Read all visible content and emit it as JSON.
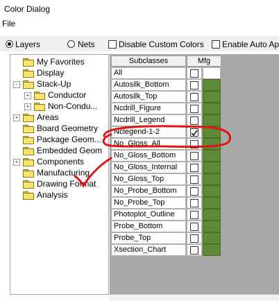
{
  "window": {
    "title": "Color Dialog"
  },
  "menubar": {
    "file": "File"
  },
  "toolbar": {
    "layers_label": "Layers",
    "nets_label": "Nets",
    "disable_custom_colors_label": "Disable Custom Colors",
    "enable_auto_apply_label": "Enable Auto Appl"
  },
  "tree": {
    "items": [
      {
        "label": "My Favorites"
      },
      {
        "label": "Display"
      },
      {
        "label": "Stack-Up",
        "expanded": true
      },
      {
        "label": "Conductor"
      },
      {
        "label": "Non-Condu..."
      },
      {
        "label": "Areas"
      },
      {
        "label": "Board Geometry"
      },
      {
        "label": "Package Geom..."
      },
      {
        "label": "Embedded Geom"
      },
      {
        "label": "Components"
      },
      {
        "label": "Manufacturing"
      },
      {
        "label": "Drawing Format"
      },
      {
        "label": "Analysis"
      }
    ]
  },
  "grid": {
    "header_subclasses": "Subclasses",
    "header_mfg": "Mfg",
    "mfg_color": "#5f8a35",
    "rows": [
      {
        "name": "All",
        "checked": false
      },
      {
        "name": "Autosilk_Bottom",
        "checked": false
      },
      {
        "name": "Autosilk_Top",
        "checked": false
      },
      {
        "name": "Ncdrill_Figure",
        "checked": false
      },
      {
        "name": "Ncdrill_Legend",
        "checked": false
      },
      {
        "name": "Nclegend-1-2",
        "checked": true
      },
      {
        "name": "No_Gloss_All",
        "checked": false
      },
      {
        "name": "No_Gloss_Bottom",
        "checked": false
      },
      {
        "name": "No_Gloss_Internal",
        "checked": false
      },
      {
        "name": "No_Gloss_Top",
        "checked": false
      },
      {
        "name": "No_Probe_Bottom",
        "checked": false
      },
      {
        "name": "No_Probe_Top",
        "checked": false
      },
      {
        "name": "Photoplot_Outline",
        "checked": false
      },
      {
        "name": "Probe_Bottom",
        "checked": false
      },
      {
        "name": "Probe_Top",
        "checked": false
      },
      {
        "name": "Xsection_Chart",
        "checked": false
      }
    ]
  },
  "annotation": {
    "color": "#e31414"
  }
}
